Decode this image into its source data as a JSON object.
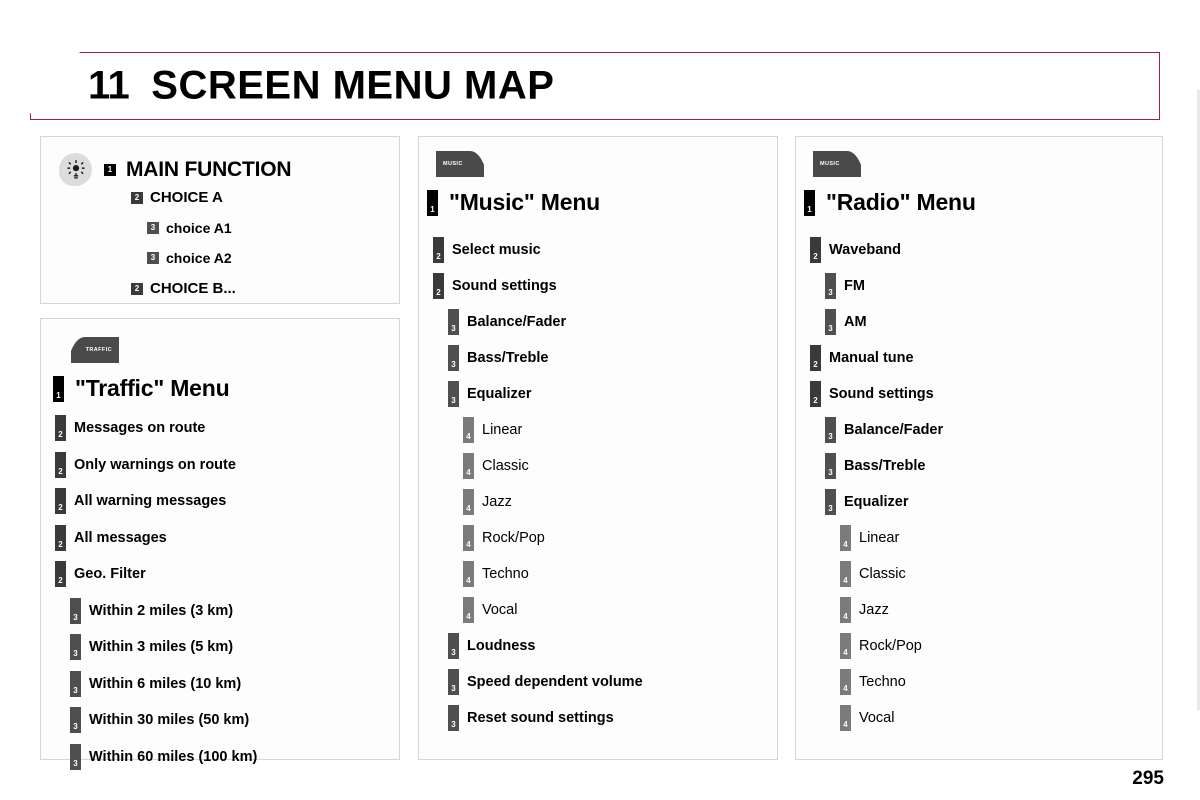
{
  "header": {
    "chapter_number": "11",
    "title": "SCREEN MENU MAP"
  },
  "page_number": "295",
  "legend_panel": {
    "icon": "sun-settings-icon",
    "title": "MAIN FUNCTION",
    "title_level": "1",
    "items": [
      {
        "level": "2",
        "label": "CHOICE A",
        "indent": 0
      },
      {
        "level": "3",
        "label": "choice A1",
        "indent": 1
      },
      {
        "level": "3",
        "label": "choice A2",
        "indent": 1
      },
      {
        "level": "2",
        "label": "CHOICE B...",
        "indent": 0
      }
    ]
  },
  "traffic_panel": {
    "tab_icon_label": "TRAFFIC",
    "title": "\"Traffic\" Menu",
    "title_level": "1",
    "items": [
      {
        "level": "2",
        "label": "Messages on route"
      },
      {
        "level": "2",
        "label": "Only warnings on route"
      },
      {
        "level": "2",
        "label": "All warning messages"
      },
      {
        "level": "2",
        "label": "All messages"
      },
      {
        "level": "2",
        "label": "Geo. Filter"
      },
      {
        "level": "3",
        "label": "Within 2 miles (3 km)"
      },
      {
        "level": "3",
        "label": "Within 3 miles (5 km)"
      },
      {
        "level": "3",
        "label": "Within 6 miles (10 km)"
      },
      {
        "level": "3",
        "label": "Within 30 miles (50 km)"
      },
      {
        "level": "3",
        "label": "Within 60 miles (100 km)"
      }
    ]
  },
  "music_panel": {
    "tab_icon_label": "MUSIC",
    "title": "\"Music\" Menu",
    "title_level": "1",
    "items": [
      {
        "level": "2",
        "label": "Select music"
      },
      {
        "level": "2",
        "label": "Sound settings"
      },
      {
        "level": "3",
        "label": "Balance/Fader"
      },
      {
        "level": "3",
        "label": "Bass/Treble"
      },
      {
        "level": "3",
        "label": "Equalizer"
      },
      {
        "level": "4",
        "label": "Linear"
      },
      {
        "level": "4",
        "label": "Classic"
      },
      {
        "level": "4",
        "label": "Jazz"
      },
      {
        "level": "4",
        "label": "Rock/Pop"
      },
      {
        "level": "4",
        "label": "Techno"
      },
      {
        "level": "4",
        "label": "Vocal"
      },
      {
        "level": "3",
        "label": "Loudness"
      },
      {
        "level": "3",
        "label": "Speed dependent volume"
      },
      {
        "level": "3",
        "label": "Reset sound settings"
      }
    ]
  },
  "radio_panel": {
    "tab_icon_label": "MUSIC",
    "title": "\"Radio\" Menu",
    "title_level": "1",
    "items": [
      {
        "level": "2",
        "label": "Waveband"
      },
      {
        "level": "3",
        "label": "FM"
      },
      {
        "level": "3",
        "label": "AM"
      },
      {
        "level": "2",
        "label": "Manual tune"
      },
      {
        "level": "2",
        "label": "Sound settings"
      },
      {
        "level": "3",
        "label": "Balance/Fader"
      },
      {
        "level": "3",
        "label": "Bass/Treble"
      },
      {
        "level": "3",
        "label": "Equalizer"
      },
      {
        "level": "4",
        "label": "Linear"
      },
      {
        "level": "4",
        "label": "Classic"
      },
      {
        "level": "4",
        "label": "Jazz"
      },
      {
        "level": "4",
        "label": "Rock/Pop"
      },
      {
        "level": "4",
        "label": "Techno"
      },
      {
        "level": "4",
        "label": "Vocal"
      }
    ]
  },
  "colors": {
    "header_border": "#A51F3E",
    "level1": "#000000",
    "level2": "#3a3a3a",
    "level3": "#4f4f4f",
    "level4": "#7b7b7b",
    "panel_border": "#d6d6d6"
  }
}
